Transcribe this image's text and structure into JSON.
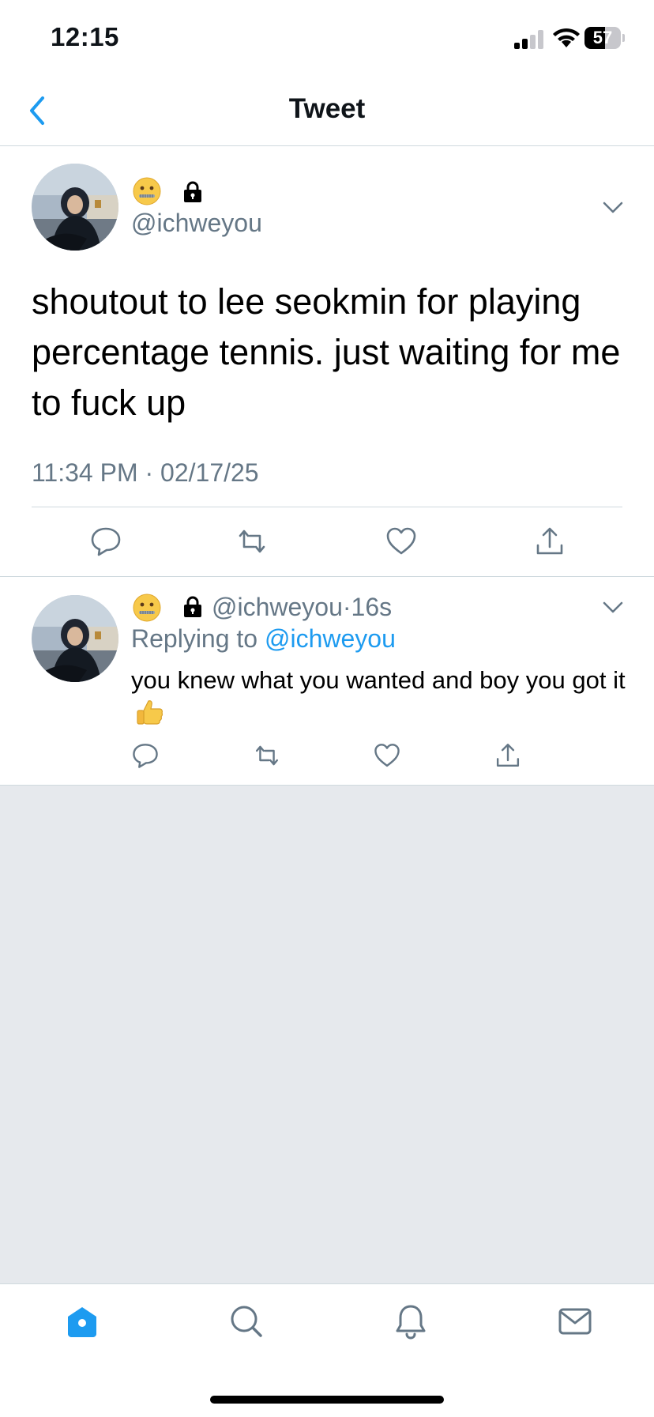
{
  "status_bar": {
    "time": "12:15",
    "battery_level": "57",
    "battery_fraction": 0.57
  },
  "header": {
    "title": "Tweet",
    "back_icon": "chevron-left-icon"
  },
  "tweet": {
    "handle": "@ichweyou",
    "name_emoji": "zipper-mouth-face-icon",
    "protected_icon": "lock-icon",
    "text": "shoutout to lee seokmin for playing percentage tennis. just waiting for me to fuck up",
    "timestamp": "11:34 PM · 02/17/25",
    "actions": [
      "reply-icon",
      "retweet-icon",
      "like-icon",
      "share-icon"
    ]
  },
  "reply": {
    "handle": "@ichweyou",
    "separator": "·",
    "time": "16s",
    "replying_prefix": "Replying to ",
    "replying_to": "@ichweyou",
    "text": "you knew what you wanted and boy you got it",
    "text_emoji": "thumbs-up-icon",
    "actions": [
      "reply-icon",
      "retweet-icon",
      "like-icon",
      "share-icon"
    ]
  },
  "tab_bar": {
    "items": [
      "home-icon",
      "search-icon",
      "notifications-icon",
      "messages-icon"
    ],
    "active": "home-icon"
  },
  "colors": {
    "accent": "#1d9bf0",
    "secondary_text": "#657786",
    "feed_background": "#e6e9ed"
  }
}
